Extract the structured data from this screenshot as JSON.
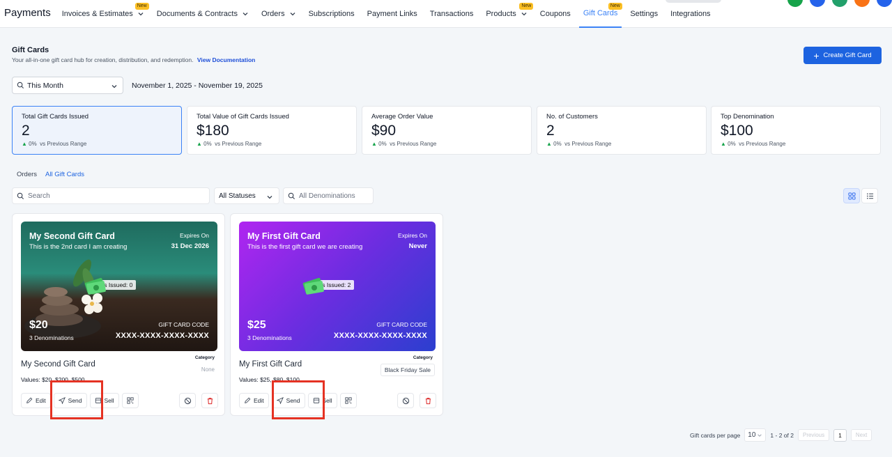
{
  "nav": {
    "brand": "Payments",
    "items": [
      {
        "label": "Invoices & Estimates",
        "dropdown": true,
        "badge": "New"
      },
      {
        "label": "Documents & Contracts",
        "dropdown": true
      },
      {
        "label": "Orders",
        "dropdown": true
      },
      {
        "label": "Subscriptions"
      },
      {
        "label": "Payment Links"
      },
      {
        "label": "Transactions"
      },
      {
        "label": "Products",
        "dropdown": true,
        "badge": "New"
      },
      {
        "label": "Coupons"
      },
      {
        "label": "Gift Cards",
        "badge": "New",
        "active": true
      },
      {
        "label": "Settings"
      },
      {
        "label": "Integrations"
      }
    ]
  },
  "header": {
    "title": "Gift Cards",
    "subtitle": "Your all-in-one gift card hub for creation, distribution, and redemption.",
    "doc_link": "View Documentation",
    "create_button": "Create Gift Card"
  },
  "filters": {
    "range": "This Month",
    "date_range": "November 1, 2025 - November 19, 2025",
    "search_placeholder": "Search",
    "status": "All Statuses",
    "denominations_placeholder": "All Denominations"
  },
  "stats": [
    {
      "label": "Total Gift Cards Issued",
      "value": "2",
      "change": "0%",
      "change_text": "vs Previous Range"
    },
    {
      "label": "Total Value of Gift Cards Issued",
      "value": "$180",
      "change": "0%",
      "change_text": "vs Previous Range"
    },
    {
      "label": "Average Order Value",
      "value": "$90",
      "change": "0%",
      "change_text": "vs Previous Range"
    },
    {
      "label": "No. of Customers",
      "value": "2",
      "change": "0%",
      "change_text": "vs Previous Range"
    },
    {
      "label": "Top Denomination",
      "value": "$100",
      "change": "0%",
      "change_text": "vs Previous Range"
    }
  ],
  "tabs": [
    "Orders",
    "All Gift Cards"
  ],
  "cards": [
    {
      "title": "My Second Gift Card",
      "description": "This is the 2nd card I am creating",
      "expires_label": "Expires On",
      "expires_value": "31 Dec 2026",
      "issued": "its Issued: 0",
      "amount": "$20",
      "denominations": "3 Denominations",
      "code_label": "GIFT CARD CODE",
      "code": "XXXX-XXXX-XXXX-XXXX",
      "name": "My Second Gift Card",
      "values": "Values: $20, $200, $500",
      "category_label": "Category",
      "category": "None"
    },
    {
      "title": "My First Gift Card",
      "description": "This is the first gift card we are creating",
      "expires_label": "Expires On",
      "expires_value": "Never",
      "issued": "its Issued: 2",
      "amount": "$25",
      "denominations": "3 Denominations",
      "code_label": "GIFT CARD CODE",
      "code": "XXXX-XXXX-XXXX-XXXX",
      "name": "My First Gift Card",
      "values": "Values: $25, $80, $100",
      "category_label": "Category",
      "category": "Black Friday Sale"
    }
  ],
  "actions": {
    "edit": "Edit",
    "send": "Send",
    "sell": "Sell"
  },
  "pagination": {
    "per_page_label": "Gift cards per page",
    "per_page": "10",
    "range": "1 - 2 of 2",
    "previous": "Previous",
    "page": "1",
    "next": "Next"
  }
}
